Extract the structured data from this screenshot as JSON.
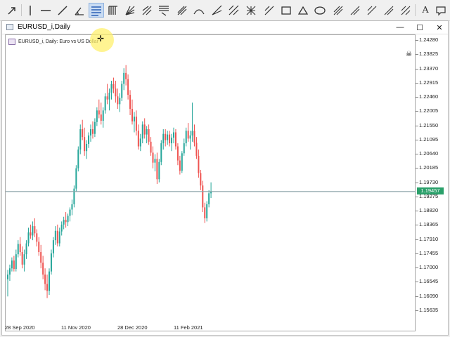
{
  "toolbar": {
    "tools": [
      {
        "name": "arrow-cursor-icon"
      },
      {
        "name": "vertical-line-icon"
      },
      {
        "name": "horizontal-line-icon"
      },
      {
        "name": "trendline-icon"
      },
      {
        "name": "angle-tool-icon"
      },
      {
        "name": "fibonacci-retracement-icon",
        "active": true
      },
      {
        "name": "fibonacci-levels-icon"
      },
      {
        "name": "fibonacci-fan-icon"
      },
      {
        "name": "fibonacci-expansion-icon"
      },
      {
        "name": "pitchfork-icon"
      },
      {
        "name": "arc-icon"
      },
      {
        "name": "ellipse-wave-icon"
      },
      {
        "name": "gann-icon"
      },
      {
        "name": "gann-grid-icon"
      },
      {
        "name": "rectangle-icon"
      },
      {
        "name": "ellipse-icon"
      },
      {
        "name": "cycle-lines-icon"
      },
      {
        "name": "wave-abcde-icon"
      },
      {
        "name": "wave-numbers-icon"
      },
      {
        "name": "text-tool-icon"
      },
      {
        "name": "label-tool-icon"
      }
    ],
    "text_tool_letter": "A"
  },
  "window": {
    "title": "EURUSD_i,Daily",
    "minimize_glyph": "—",
    "maximize_glyph": "☐",
    "close_glyph": "✕"
  },
  "chart_data": {
    "type": "candlestick",
    "label": "EURUSD_i, Daily:  Euro vs US Dollar",
    "y_ticks": [
      "1.24280",
      "1.23825",
      "1.23370",
      "1.22915",
      "1.22460",
      "1.22005",
      "1.21550",
      "1.21095",
      "1.20640",
      "1.20185",
      "1.19730",
      "1.19275",
      "1.18820",
      "1.18365",
      "1.17910",
      "1.17455",
      "1.17000",
      "1.16545",
      "1.16090",
      "1.15635"
    ],
    "x_ticks": [
      "28 Sep 2020",
      "11 Nov 2020",
      "28 Dec 2020",
      "11 Feb 2021"
    ],
    "current_price": "1.19457",
    "current_price_value": 1.19457,
    "ylim": [
      1.15635,
      1.2428
    ],
    "colors": {
      "up": "#26a69a",
      "down": "#ef5350",
      "current_line": "#2aa06a"
    },
    "candles": [
      [
        1.1665,
        1.1695,
        1.161,
        1.168
      ],
      [
        1.168,
        1.1712,
        1.166,
        1.17
      ],
      [
        1.17,
        1.1735,
        1.169,
        1.1725
      ],
      [
        1.1725,
        1.174,
        1.169,
        1.1698
      ],
      [
        1.1698,
        1.176,
        1.169,
        1.1745
      ],
      [
        1.1745,
        1.179,
        1.1735,
        1.1778
      ],
      [
        1.1778,
        1.18,
        1.174,
        1.1752
      ],
      [
        1.1752,
        1.177,
        1.17,
        1.1712
      ],
      [
        1.1712,
        1.176,
        1.169,
        1.1745
      ],
      [
        1.1745,
        1.179,
        1.173,
        1.178
      ],
      [
        1.178,
        1.183,
        1.177,
        1.1815
      ],
      [
        1.1815,
        1.184,
        1.1795,
        1.1805
      ],
      [
        1.1805,
        1.185,
        1.179,
        1.1835
      ],
      [
        1.1835,
        1.186,
        1.18,
        1.1812
      ],
      [
        1.1812,
        1.1825,
        1.177,
        1.1785
      ],
      [
        1.1785,
        1.18,
        1.174,
        1.1752
      ],
      [
        1.1752,
        1.1775,
        1.17,
        1.1718
      ],
      [
        1.1718,
        1.174,
        1.1665,
        1.168
      ],
      [
        1.168,
        1.17,
        1.163,
        1.165
      ],
      [
        1.165,
        1.168,
        1.1605,
        1.1628
      ],
      [
        1.1628,
        1.17,
        1.1615,
        1.169
      ],
      [
        1.169,
        1.176,
        1.168,
        1.1748
      ],
      [
        1.1748,
        1.18,
        1.1735,
        1.179
      ],
      [
        1.179,
        1.1835,
        1.1775,
        1.182
      ],
      [
        1.182,
        1.184,
        1.177,
        1.178
      ],
      [
        1.178,
        1.183,
        1.177,
        1.1818
      ],
      [
        1.1818,
        1.185,
        1.1805,
        1.184
      ],
      [
        1.184,
        1.1865,
        1.1825,
        1.1855
      ],
      [
        1.1855,
        1.188,
        1.183,
        1.1848
      ],
      [
        1.1848,
        1.1875,
        1.1835,
        1.1868
      ],
      [
        1.1868,
        1.1895,
        1.185,
        1.1888
      ],
      [
        1.1888,
        1.192,
        1.187,
        1.1905
      ],
      [
        1.1905,
        1.1965,
        1.1895,
        1.1955
      ],
      [
        1.1955,
        1.203,
        1.1945,
        1.202
      ],
      [
        1.202,
        1.209,
        1.201,
        1.208
      ],
      [
        1.208,
        1.216,
        1.2065,
        1.2145
      ],
      [
        1.2145,
        1.2175,
        1.211,
        1.212
      ],
      [
        1.212,
        1.215,
        1.206,
        1.2075
      ],
      [
        1.2075,
        1.211,
        1.205,
        1.2098
      ],
      [
        1.2098,
        1.2135,
        1.2085,
        1.2125
      ],
      [
        1.2125,
        1.216,
        1.2105,
        1.2145
      ],
      [
        1.2145,
        1.217,
        1.2115,
        1.213
      ],
      [
        1.213,
        1.218,
        1.212,
        1.2168
      ],
      [
        1.2168,
        1.2215,
        1.2155,
        1.2205
      ],
      [
        1.2205,
        1.224,
        1.218,
        1.2192
      ],
      [
        1.2192,
        1.223,
        1.216,
        1.2172
      ],
      [
        1.2172,
        1.2215,
        1.215,
        1.2205
      ],
      [
        1.2205,
        1.226,
        1.2195,
        1.225
      ],
      [
        1.225,
        1.229,
        1.2225,
        1.224
      ],
      [
        1.224,
        1.2275,
        1.2205,
        1.2262
      ],
      [
        1.2262,
        1.23,
        1.224,
        1.229
      ],
      [
        1.229,
        1.231,
        1.226,
        1.2275
      ],
      [
        1.2275,
        1.23,
        1.223,
        1.225
      ],
      [
        1.225,
        1.2275,
        1.221,
        1.2225
      ],
      [
        1.2225,
        1.226,
        1.22,
        1.2245
      ],
      [
        1.2245,
        1.23,
        1.2235,
        1.229
      ],
      [
        1.229,
        1.234,
        1.227,
        1.2325
      ],
      [
        1.2325,
        1.235,
        1.2285,
        1.2305
      ],
      [
        1.2305,
        1.232,
        1.224,
        1.2255
      ],
      [
        1.2255,
        1.227,
        1.219,
        1.221
      ],
      [
        1.221,
        1.224,
        1.216,
        1.217
      ],
      [
        1.217,
        1.22,
        1.2135,
        1.2185
      ],
      [
        1.2185,
        1.2205,
        1.2125,
        1.214
      ],
      [
        1.214,
        1.216,
        1.208,
        1.209
      ],
      [
        1.209,
        1.213,
        1.2075,
        1.2115
      ],
      [
        1.2115,
        1.217,
        1.21,
        1.216
      ],
      [
        1.216,
        1.218,
        1.2115,
        1.2128
      ],
      [
        1.2128,
        1.2155,
        1.21,
        1.2145
      ],
      [
        1.2145,
        1.216,
        1.2095,
        1.2105
      ],
      [
        1.2105,
        1.212,
        1.206,
        1.207
      ],
      [
        1.207,
        1.209,
        1.202,
        1.2038
      ],
      [
        1.2038,
        1.2065,
        1.201,
        1.205
      ],
      [
        1.205,
        1.207,
        1.197,
        1.1985
      ],
      [
        1.1985,
        1.205,
        1.1975,
        1.204
      ],
      [
        1.204,
        1.211,
        1.203,
        1.21
      ],
      [
        1.21,
        1.2145,
        1.208,
        1.213
      ],
      [
        1.213,
        1.2145,
        1.209,
        1.211
      ],
      [
        1.211,
        1.214,
        1.2095,
        1.2128
      ],
      [
        1.2128,
        1.214,
        1.209,
        1.21
      ],
      [
        1.21,
        1.213,
        1.2075,
        1.2118
      ],
      [
        1.2118,
        1.215,
        1.21,
        1.2135
      ],
      [
        1.2135,
        1.2145,
        1.208,
        1.209
      ],
      [
        1.209,
        1.21,
        1.203,
        1.2045
      ],
      [
        1.2045,
        1.206,
        1.2,
        1.2012
      ],
      [
        1.2012,
        1.2075,
        1.2005,
        1.2068
      ],
      [
        1.2068,
        1.2115,
        1.206,
        1.21
      ],
      [
        1.21,
        1.215,
        1.209,
        1.214
      ],
      [
        1.214,
        1.2165,
        1.2105,
        1.2115
      ],
      [
        1.2115,
        1.214,
        1.208,
        1.2125
      ],
      [
        1.2125,
        1.223,
        1.2105,
        1.214
      ],
      [
        1.214,
        1.216,
        1.209,
        1.2102
      ],
      [
        1.2102,
        1.212,
        1.205,
        1.206
      ],
      [
        1.206,
        1.208,
        1.199,
        1.2005
      ],
      [
        1.2005,
        1.2015,
        1.195,
        1.1965
      ],
      [
        1.1965,
        1.198,
        1.188,
        1.1895
      ],
      [
        1.1895,
        1.191,
        1.1845,
        1.186
      ],
      [
        1.186,
        1.1915,
        1.185,
        1.1905
      ],
      [
        1.1905,
        1.195,
        1.1895,
        1.194
      ],
      [
        1.194,
        1.1975,
        1.1925,
        1.1946
      ]
    ]
  }
}
